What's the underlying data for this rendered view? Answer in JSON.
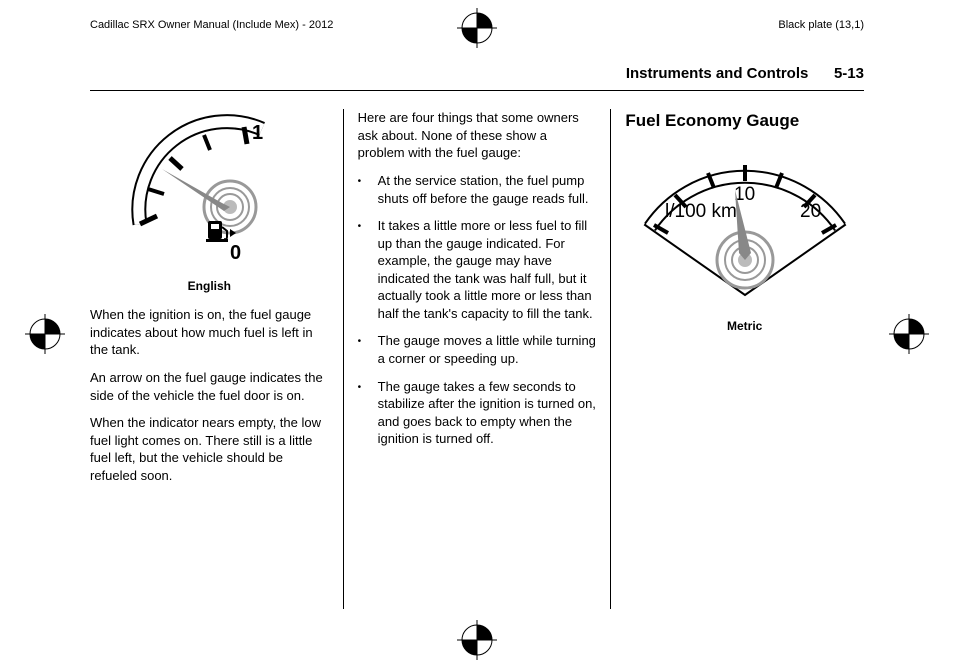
{
  "header": {
    "left": "Cadillac SRX Owner Manual (Include Mex) - 2012",
    "right": "Black plate (13,1)"
  },
  "sectionHeader": {
    "title": "Instruments and Controls",
    "page": "5-13"
  },
  "col1": {
    "gaugeCaption": "English",
    "p1": "When the ignition is on, the fuel gauge indicates about how much fuel is left in the tank.",
    "p2": "An arrow on the fuel gauge indicates the side of the vehicle the fuel door is on.",
    "p3": "When the indicator nears empty, the low fuel light comes on. There still is a little fuel left, but the vehicle should be refueled soon."
  },
  "col2": {
    "intro": "Here are four things that some owners ask about. None of these show a problem with the fuel gauge:",
    "bullets": [
      "At the service station, the fuel pump shuts off before the gauge reads full.",
      "It takes a little more or less fuel to fill up than the gauge indicated. For example, the gauge may have indicated the tank was half full, but it actually took a little more or less than half the tank's capacity to fill the tank.",
      "The gauge moves a little while turning a corner or speeding up.",
      "The gauge takes a few seconds to stabilize after the ignition is turned on, and goes back to empty when the ignition is turned off."
    ]
  },
  "col3": {
    "heading": "Fuel Economy Gauge",
    "gaugeCaption": "Metric",
    "gaugeLabels": {
      "unit": "l/100 km",
      "v10": "10",
      "v20": "20"
    }
  },
  "gauge1Labels": {
    "one": "1",
    "zero": "0"
  }
}
